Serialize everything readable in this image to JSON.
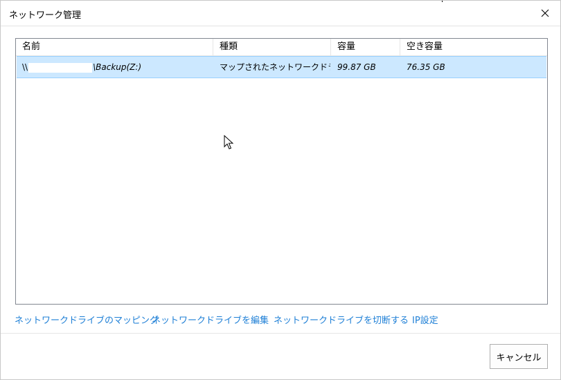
{
  "window": {
    "title": "ネットワーク管理"
  },
  "table": {
    "columns": [
      "名前",
      "種類",
      "容量",
      "空き容量"
    ],
    "rows": [
      {
        "name_prefix": "\\\\",
        "name_suffix": "\\Backup(Z:)",
        "type": "マップされたネットワークドラ...",
        "capacity": "99.87 GB",
        "free": "76.35 GB"
      }
    ]
  },
  "links": {
    "map": "ネットワークドライブのマッピング",
    "edit": "ネットワークドライブを編集",
    "disconnect": "ネットワークドライブを切断する",
    "ip": "IP設定"
  },
  "buttons": {
    "cancel": "キャンセル"
  },
  "icons": {
    "close": "close-icon",
    "cursor": "mouse-pointer-icon"
  },
  "colors": {
    "selection": "#cce8ff",
    "selection_border": "#99d1ff",
    "link": "#1e7fd6"
  }
}
